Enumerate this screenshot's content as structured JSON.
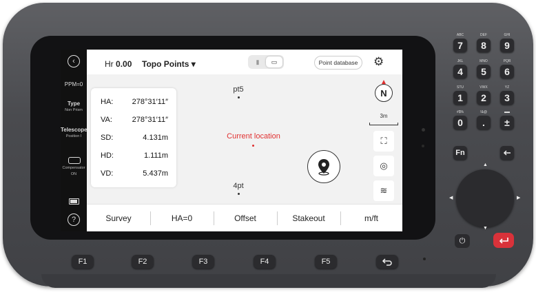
{
  "sidebar": {
    "ppm": "PPM=0",
    "type_label": "Type",
    "type_value": "Non Prism",
    "telescope_label": "Telescope",
    "telescope_value": "Position I",
    "compensator_text": "Compensator ON",
    "help": "?"
  },
  "topbar": {
    "hr_label": "Hr",
    "hr_value": "0.00",
    "mode": "Topo Points ▾",
    "point_database": "Point database"
  },
  "measurements": [
    {
      "key": "HA:",
      "value": "278°31′11″"
    },
    {
      "key": "VA:",
      "value": "278°31′11″"
    },
    {
      "key": "SD:",
      "value": "4.131m"
    },
    {
      "key": "HD:",
      "value": "1.111m"
    },
    {
      "key": "VD:",
      "value": "5.437m"
    }
  ],
  "map": {
    "point_top": "pt5",
    "point_bottom": "4pt",
    "current_location": "Current location",
    "compass_letter": "N",
    "scale": "3m"
  },
  "softkeys": [
    "Survey",
    "HA=0",
    "Offset",
    "Stakeout",
    "m/ft"
  ],
  "fkeys": [
    "F1",
    "F2",
    "F3",
    "F4",
    "F5"
  ],
  "keypad": {
    "row1": [
      {
        "l": "ABC",
        "k": "7"
      },
      {
        "l": "DEF",
        "k": "8"
      },
      {
        "l": "GHI",
        "k": "9"
      }
    ],
    "row2": [
      {
        "l": "JKL",
        "k": "4"
      },
      {
        "l": "MNO",
        "k": "5"
      },
      {
        "l": "PQR",
        "k": "6"
      }
    ],
    "row3": [
      {
        "l": "STU",
        "k": "1"
      },
      {
        "l": "VWX",
        "k": "2"
      },
      {
        "l": "YZ",
        "k": "3"
      }
    ],
    "row4": [
      {
        "l": "#$%",
        "k": "0"
      },
      {
        "l": "!&@",
        "k": "."
      },
      {
        "l": "",
        "k": "±"
      }
    ],
    "fn": "Fn"
  },
  "colors": {
    "accent_red": "#e03030",
    "device": "#4a4b4f",
    "screen_bg": "#f2f2f2"
  }
}
